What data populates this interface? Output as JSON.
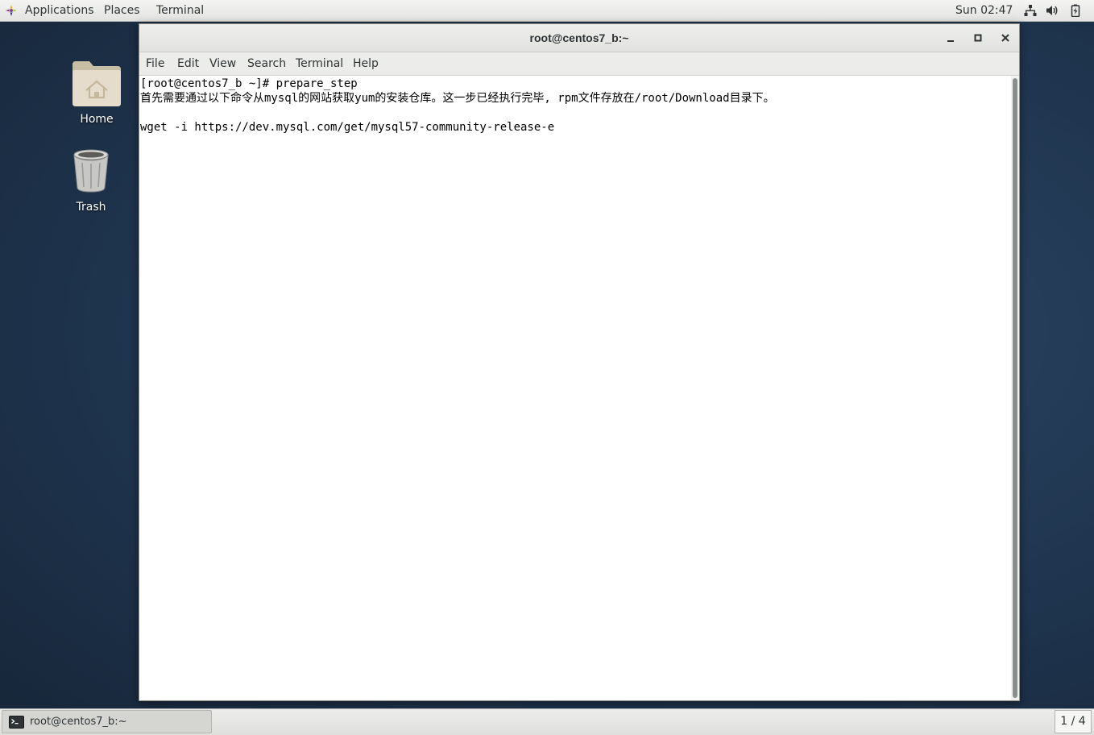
{
  "top_panel": {
    "applications_label": "Applications",
    "places_label": "Places",
    "terminal_label": "Terminal",
    "clock": "Sun 02:47"
  },
  "desktop": {
    "icons": [
      {
        "label": "Home",
        "icon": "home-folder-icon"
      },
      {
        "label": "Trash",
        "icon": "trash-icon"
      }
    ]
  },
  "window": {
    "title": "root@centos7_b:~",
    "menu": [
      "File",
      "Edit",
      "View",
      "Search",
      "Terminal",
      "Help"
    ],
    "terminal_lines": [
      "[root@centos7_b ~]# prepare_step",
      "首先需要通过以下命令从mysql的网站获取yum的安装仓库。这一步已经执行完毕, rpm文件存放在/root/Download目录下。",
      "",
      "wget -i https://dev.mysql.com/get/mysql57-community-release-e"
    ]
  },
  "taskbar": {
    "task_label": "root@centos7_b:~",
    "workspace": "1 / 4"
  },
  "colors": {
    "desktop_background": "#243c58",
    "panel_background": "#ededeb",
    "terminal_background": "#ffffff",
    "terminal_text": "#000000"
  }
}
